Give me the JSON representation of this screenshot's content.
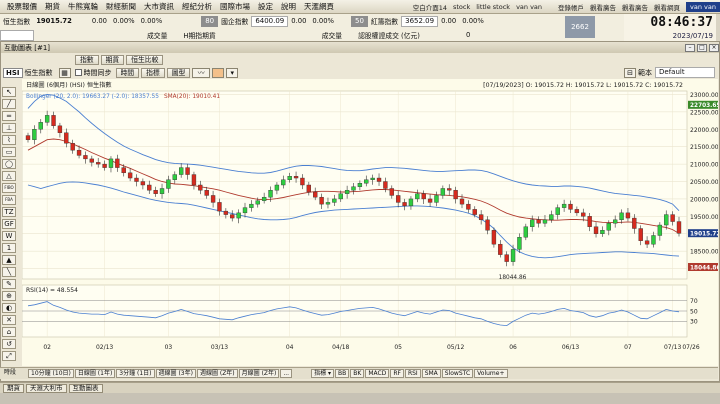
{
  "menubar": {
    "items": [
      "股票報價",
      "期貨",
      "牛熊寬輪",
      "財經新聞",
      "大市資訊",
      "經紀分析",
      "國際市場",
      "設定",
      "說明",
      "天滙網頁"
    ],
    "tickers": [
      "空白介面14",
      "stock",
      "little stock",
      "van van"
    ],
    "right_links": [
      "登錄帳戶",
      "觀看廣告",
      "觀看廣告",
      "觀看網頁"
    ],
    "user": "van van"
  },
  "clock": {
    "time": "08:46:37",
    "date": "2023/07/19"
  },
  "quote_row1": {
    "label1": "恒生指數",
    "value1": "19015.72",
    "change1": "0.00",
    "pct1": "0.00%",
    "pct1b": "0.00%",
    "label2": "國企指數",
    "box2": "80",
    "value2": "6400.09",
    "change2": "0.00",
    "pct2": "0.00%",
    "label3": "紅籌指數",
    "box3": "50",
    "value3": "3652.09",
    "change3": "0.00",
    "pct3": "0.00%"
  },
  "quote_row2": {
    "a": "成交量",
    "b": "H期指期貨",
    "c": "成交量",
    "d": "認股權證成交 (亿元)",
    "e": "0",
    "logo": "2662"
  },
  "window": {
    "title": "互動圖表 [#1]"
  },
  "toolbar1": {
    "tabs": [
      "指數",
      "期貨",
      "恒生比較"
    ]
  },
  "toolbar2": {
    "code": "HSI",
    "name": "恒生指數",
    "sync_label": "時間同步",
    "buttons": [
      "時間",
      "指標",
      "圖型"
    ],
    "style_label": "範本",
    "style_value": "Default"
  },
  "tools": [
    "↖",
    "╱",
    "═",
    "⊥",
    "⌇",
    "▭",
    "◯",
    "△",
    "FIBO",
    "FBA",
    "TZ",
    "GF",
    "W",
    "1",
    "▲",
    "╲",
    "✎",
    "⊕",
    "◐",
    "✕",
    "⌂",
    "↺",
    "⤢"
  ],
  "timeframes": [
    "時段",
    "10分鐘 (10日)",
    "日線圖 (1年)",
    "3分鐘 (1日)",
    "週線圖 (3年)",
    "週線圖 (Z年)",
    "月線圖 (Z年)",
    "..."
  ],
  "indicator_bar": {
    "label": "指標",
    "buttons": [
      "BB",
      "BK",
      "MACD",
      "RF",
      "RSI",
      "SMA",
      "SlowSTC",
      "Volume+"
    ]
  },
  "statusbar": {
    "tabs": [
      "期貨",
      "天滙大利市",
      "互動圖表"
    ]
  },
  "chart_data": {
    "type": "candlestick",
    "main_header": "日線圖 (6個月) (HSI) 恒生指數",
    "ohlc_label": "[07/19/2023] O: 19015.72 H: 19015.72 L: 19015.72 C: 19015.72",
    "indicator_label_bb": "Bollinger (20, 2.0): 19663.27 (-2.0): 18357.55",
    "indicator_label_sma": "SMA(20): 19010.41",
    "rsi_label": "RSI(14) = 48.554",
    "y_ticks": [
      "23000.00",
      "22500.00",
      "22000.00",
      "21500.00",
      "21000.00",
      "20500.00",
      "20000.00",
      "19500.00",
      "19000.00",
      "18500.00",
      "18000.00"
    ],
    "ylim": [
      17700,
      23100
    ],
    "last_price": "19015.72",
    "top_tag": "22703.65",
    "bottom_tag": "18044.86",
    "low_annotation": "18044.86",
    "rsi_ticks": [
      "70",
      "50",
      "30"
    ],
    "rsi_value": 48.554,
    "x_ticks": [
      "02",
      "02/13",
      "03",
      "03/13",
      "04",
      "04/18",
      "05",
      "05/12",
      "06",
      "06/13",
      "07",
      "07/13",
      "07/26"
    ],
    "close": [
      21700,
      22000,
      22200,
      22400,
      22100,
      21900,
      21600,
      21400,
      21250,
      21150,
      21050,
      21000,
      20900,
      21150,
      20900,
      20750,
      20600,
      20500,
      20400,
      20250,
      20150,
      20300,
      20550,
      20700,
      20900,
      20700,
      20400,
      20250,
      20100,
      19900,
      19650,
      19550,
      19450,
      19600,
      19750,
      19850,
      19950,
      20050,
      20250,
      20400,
      20550,
      20650,
      20600,
      20400,
      20200,
      20050,
      19850,
      19900,
      20000,
      20150,
      20250,
      20350,
      20450,
      20550,
      20600,
      20500,
      20300,
      20100,
      19900,
      19800,
      20000,
      20150,
      20000,
      19900,
      20100,
      20300,
      20250,
      20000,
      19850,
      19700,
      19550,
      19400,
      19100,
      18700,
      18400,
      18200,
      18550,
      18900,
      19200,
      19400,
      19300,
      19400,
      19550,
      19750,
      19850,
      19700,
      19600,
      19500,
      19200,
      19000,
      19100,
      19300,
      19400,
      19600,
      19450,
      19150,
      18800,
      18700,
      18950,
      19250,
      19550,
      19350,
      19015.72
    ],
    "sma": [
      21400,
      21500,
      21600,
      21700,
      21720,
      21700,
      21650,
      21580,
      21500,
      21420,
      21330,
      21250,
      21170,
      21100,
      21020,
      20950,
      20880,
      20800,
      20720,
      20640,
      20560,
      20500,
      20460,
      20430,
      20420,
      20400,
      20380,
      20350,
      20320,
      20290,
      20250,
      20200,
      20150,
      20100,
      20060,
      20020,
      19990,
      19980,
      19990,
      20010,
      20040,
      20080,
      20120,
      20160,
      20190,
      20210,
      20220,
      20220,
      20210,
      20200,
      20200,
      20210,
      20220,
      20240,
      20260,
      20270,
      20270,
      20260,
      20240,
      20220,
      20200,
      20180,
      20160,
      20140,
      20120,
      20110,
      20100,
      20080,
      20060,
      20030,
      19990,
      19940,
      19870,
      19780,
      19680,
      19590,
      19530,
      19480,
      19450,
      19430,
      19410,
      19400,
      19390,
      19390,
      19400,
      19410,
      19410,
      19400,
      19380,
      19350,
      19330,
      19320,
      19320,
      19330,
      19340,
      19330,
      19300,
      19270,
      19240,
      19210,
      19180,
      19120,
      19010
    ],
    "bb_upper": [
      22600,
      22800,
      22950,
      23000,
      22980,
      22900,
      22800,
      22650,
      22500,
      22330,
      22170,
      22020,
      21880,
      21750,
      21630,
      21520,
      21430,
      21350,
      21270,
      21200,
      21130,
      21080,
      21040,
      21020,
      21010,
      21000,
      20990,
      20970,
      20940,
      20910,
      20880,
      20850,
      20820,
      20790,
      20770,
      20750,
      20740,
      20740,
      20760,
      20800,
      20850,
      20900,
      20940,
      20960,
      20960,
      20950,
      20930,
      20900,
      20870,
      20840,
      20820,
      20810,
      20810,
      20830,
      20860,
      20880,
      20900,
      20900,
      20890,
      20880,
      20860,
      20840,
      20820,
      20800,
      20790,
      20790,
      20800,
      20810,
      20820,
      20830,
      20830,
      20820,
      20780,
      20720,
      20650,
      20580,
      20520,
      20470,
      20430,
      20400,
      20380,
      20370,
      20360,
      20360,
      20370,
      20370,
      20360,
      20340,
      20310,
      20270,
      20230,
      20190,
      20160,
      20140,
      20120,
      20100,
      20080,
      20050,
      20020,
      19980,
      19930,
      19850,
      19663
    ],
    "bb_lower": [
      20400,
      20350,
      20300,
      20350,
      20400,
      20450,
      20480,
      20490,
      20480,
      20460,
      20430,
      20400,
      20360,
      20310,
      20260,
      20200,
      20150,
      20100,
      20050,
      20000,
      19960,
      19930,
      19900,
      19880,
      19870,
      19850,
      19820,
      19780,
      19740,
      19700,
      19660,
      19620,
      19580,
      19540,
      19500,
      19460,
      19430,
      19410,
      19400,
      19400,
      19410,
      19430,
      19470,
      19520,
      19570,
      19610,
      19640,
      19660,
      19680,
      19690,
      19700,
      19710,
      19720,
      19730,
      19740,
      19750,
      19760,
      19770,
      19780,
      19790,
      19800,
      19800,
      19790,
      19780,
      19760,
      19740,
      19710,
      19680,
      19640,
      19590,
      19520,
      19420,
      19300,
      19150,
      18950,
      18760,
      18600,
      18480,
      18400,
      18350,
      18320,
      18310,
      18320,
      18340,
      18370,
      18400,
      18420,
      18430,
      18440,
      18450,
      18460,
      18470,
      18480,
      18480,
      18470,
      18460,
      18450,
      18440,
      18430,
      18410,
      18390,
      18370,
      18357
    ],
    "rsi": [
      60,
      62,
      65,
      68,
      61,
      57,
      52,
      48,
      46,
      45,
      44,
      44,
      43,
      48,
      44,
      42,
      41,
      40,
      39,
      38,
      37,
      41,
      46,
      49,
      53,
      49,
      45,
      43,
      41,
      38,
      35,
      34,
      33,
      37,
      40,
      43,
      45,
      47,
      51,
      54,
      56,
      58,
      56,
      52,
      48,
      45,
      42,
      43,
      46,
      49,
      51,
      53,
      55,
      56,
      57,
      54,
      50,
      46,
      43,
      41,
      45,
      49,
      46,
      44,
      48,
      52,
      51,
      46,
      43,
      40,
      37,
      35,
      30,
      26,
      23,
      22,
      30,
      36,
      42,
      46,
      44,
      46,
      49,
      53,
      55,
      51,
      49,
      47,
      41,
      38,
      41,
      46,
      48,
      52,
      48,
      42,
      36,
      35,
      41,
      47,
      53,
      50,
      48.554
    ]
  }
}
